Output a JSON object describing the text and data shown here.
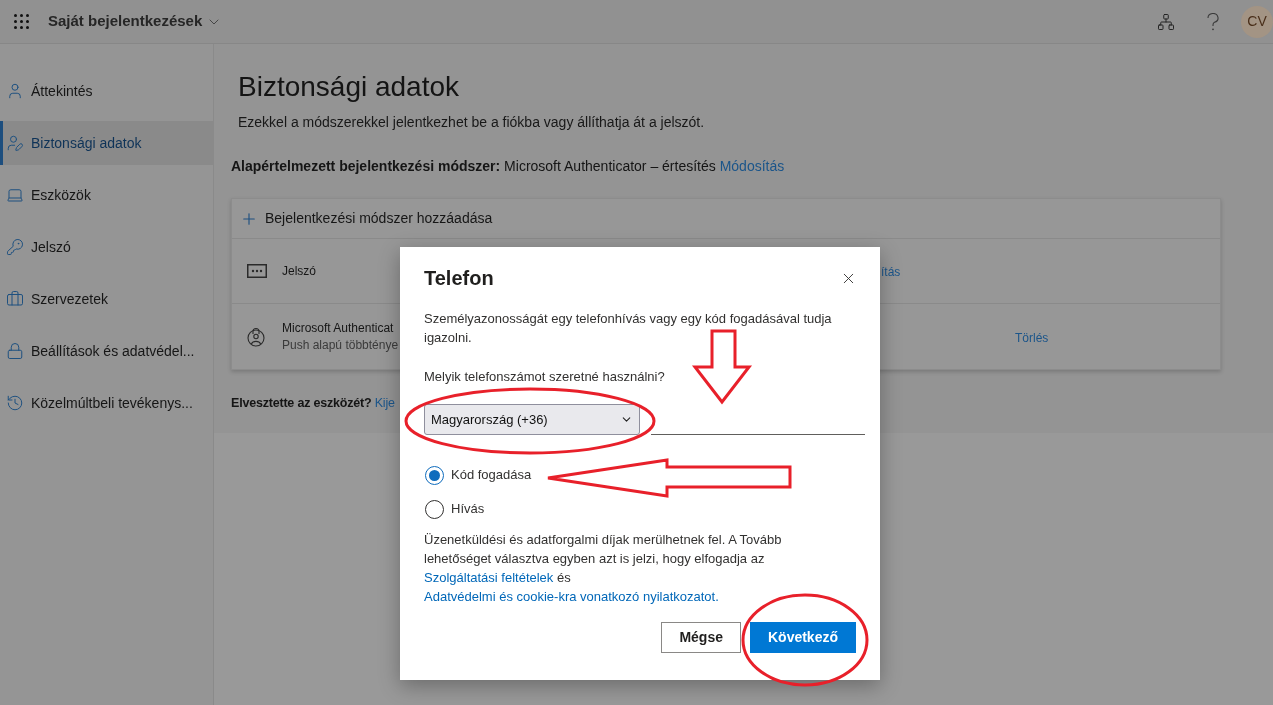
{
  "header": {
    "app_title": "Saját bejelentkezések",
    "avatar_initials": "CV"
  },
  "sidebar": {
    "items": [
      {
        "label": "Áttekintés",
        "selected": false
      },
      {
        "label": "Biztonsági adatok",
        "selected": true
      },
      {
        "label": "Eszközök",
        "selected": false
      },
      {
        "label": "Jelszó",
        "selected": false
      },
      {
        "label": "Szervezetek",
        "selected": false
      },
      {
        "label": "Beállítások és adatvédel...",
        "selected": false
      },
      {
        "label": "Közelmúltbeli tevékenys...",
        "selected": false
      }
    ]
  },
  "page": {
    "title": "Biztonsági adatok",
    "subtitle": "Ezekkel a módszerekkel jelentkezhet be a fiókba vagy állíthatja át a jelszót.",
    "default_method": {
      "text": "**Alapértelmezett bejelentkezési módszer:** Microsoft Authenticator – értesítés",
      "link": "Módosítás"
    },
    "methods_card": {
      "add_label": "Bejelentkezési módszer hozzáadása",
      "rows": [
        {
          "kind": "password",
          "name": "Jelszó",
          "change_link": "ítás"
        },
        {
          "kind": "authenticator",
          "name": "Microsoft Authenticat",
          "detail": "Push alapú többténye",
          "delete_link": "Törlés"
        }
      ]
    },
    "lost_device": {
      "question": "Elvesztette az eszközét?",
      "link": "Kije"
    }
  },
  "dialog": {
    "title": "Telefon",
    "description": "Személyazonosságát egy telefonhívás vagy egy kód fogadásával tudja igazolni.",
    "question": "Melyik telefonszámot szeretné használni?",
    "country_select": {
      "value": "Magyarország (+36)"
    },
    "options": [
      {
        "label": "Kód fogadása",
        "selected": true
      },
      {
        "label": "Hívás",
        "selected": false
      }
    ],
    "consent": [
      {
        "kind": "text",
        "text": "Üzenetküldési és adatforgalmi díjak merülhetnek fel. A Tovább lehetőséget választva egyben azt is jelzi, hogy elfogadja az"
      },
      {
        "kind": "link",
        "text": "Szolgáltatási feltételek"
      },
      {
        "kind": "text",
        "text": "és"
      },
      {
        "kind": "link",
        "text": "Adatvédelmi és cookie-kra vonatkozó nyilatkozatot."
      }
    ],
    "buttons": [
      {
        "kind": "secondary",
        "label": "Mégse"
      },
      {
        "kind": "primary",
        "label": "Következő"
      }
    ]
  }
}
